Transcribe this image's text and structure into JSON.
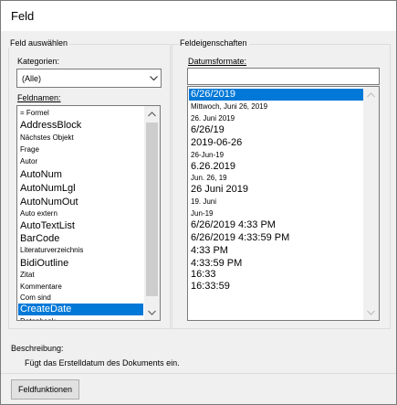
{
  "window": {
    "title": "Feld"
  },
  "left_group": {
    "title": "Feld auswählen",
    "category_label": "Kategorien:",
    "category_value": "(Alle)",
    "fieldnames_label": "Feldnamen:",
    "fields": [
      "= Formel",
      "AddressBlock",
      "Nächstes Objekt",
      "Frage",
      "Autor",
      "AutoNum",
      "AutoNumLgl",
      "AutoNumOut",
      "Auto extern",
      "AutoTextList",
      "BarCode",
      "Literaturverzeichnis",
      "BidiOutline",
      "Zitat",
      "Kommentare",
      "Com sind",
      "CreateDate",
      "Datenbank"
    ],
    "selected_field": "CreateDate"
  },
  "right_group": {
    "title": "Feldeigenschaften",
    "date_formats_label": "Datumsformate:",
    "date_format_input": "",
    "date_formats": [
      "6/26/2019",
      "Mittwoch, Juni 26, 2019",
      "26. Juni 2019",
      "6/26/19",
      "2019-06-26",
      "26-Jun-19",
      "6.26.2019",
      "Jun. 26, 19",
      "26 Juni 2019",
      "19. Juni",
      "Jun-19",
      "6/26/2019 4:33 PM",
      "6/26/2019 4:33:59 PM",
      "4:33 PM",
      "4:33:59 PM",
      "16:33",
      "16:33:59"
    ],
    "selected_date_format": "6/26/2019"
  },
  "description": {
    "label": "Beschreibung:",
    "text": "Fügt das Erstelldatum des Dokuments ein."
  },
  "buttons": {
    "field_codes": "Feldfunktionen"
  },
  "colors": {
    "selection": "#0078d7",
    "dialog_bg": "#f0f0f0"
  }
}
